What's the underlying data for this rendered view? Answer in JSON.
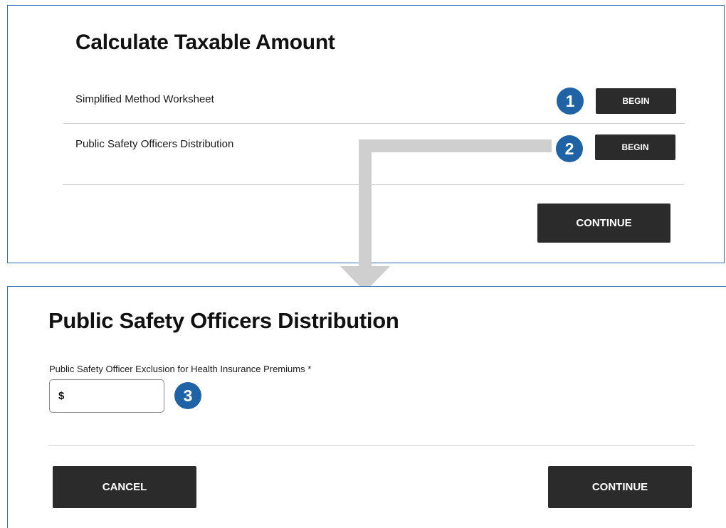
{
  "top_panel": {
    "title": "Calculate Taxable Amount",
    "rows": [
      {
        "label": "Simplified Method Worksheet",
        "button": "BEGIN",
        "step": "1"
      },
      {
        "label": "Public Safety Officers Distribution",
        "button": "BEGIN",
        "step": "2"
      }
    ],
    "continue_label": "CONTINUE"
  },
  "bottom_panel": {
    "title": "Public Safety Officers Distribution",
    "field_label": "Public Safety Officer Exclusion for Health Insurance Premiums *",
    "currency_prefix": "$",
    "field_value": "",
    "step": "3",
    "cancel_label": "CANCEL",
    "continue_label": "CONTINUE"
  },
  "colors": {
    "panel_border": "#2d6fb7",
    "button_bg": "#2b2b2b",
    "badge_bg": "#1f63a6",
    "arrow": "#cfcfcf"
  }
}
